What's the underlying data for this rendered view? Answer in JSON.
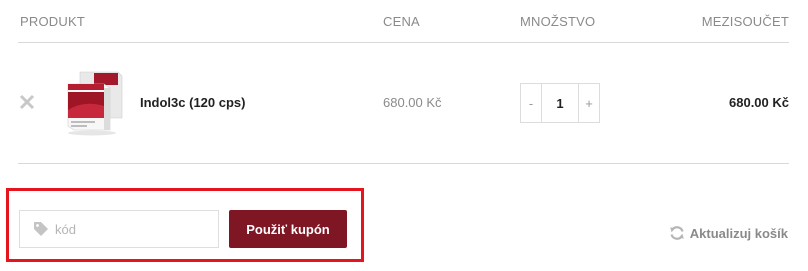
{
  "table": {
    "headers": {
      "product": "PRODUKT",
      "price": "CENA",
      "quantity": "MNOŽSTVO",
      "subtotal": "MEZISOUČET"
    }
  },
  "cart_item": {
    "name": "Indol3c (120 cps)",
    "price": "680.00 Kč",
    "quantity": "1",
    "subtotal": "680.00 Kč",
    "minus_symbol": "-",
    "plus_symbol": "+",
    "remove_icon": "close-icon",
    "product_brand_text": "Indol3c"
  },
  "coupon": {
    "placeholder": "kód",
    "value": "",
    "icon": "tag-icon",
    "apply_label": "Použiť kupón"
  },
  "update_cart": {
    "label": "Aktualizuj košík",
    "icon": "refresh-icon"
  },
  "colors": {
    "accent": "#7f1623",
    "highlight_box": "#e5141e"
  }
}
